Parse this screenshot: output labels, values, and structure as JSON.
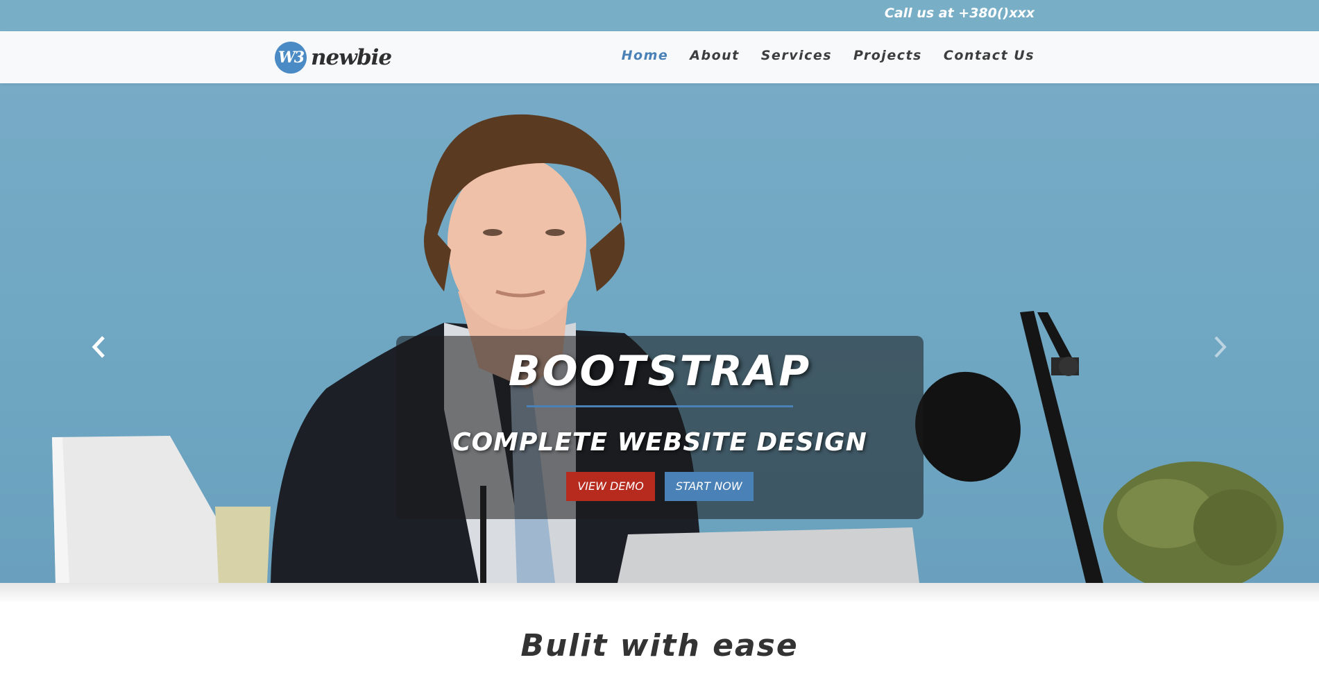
{
  "topbar": {
    "phone_text": "Call us at +380()xxx"
  },
  "brand": {
    "badge": "W3",
    "name": "newbie"
  },
  "nav": {
    "items": [
      "Home",
      "About",
      "Services",
      "Projects",
      "Contact Us"
    ],
    "active": "Home"
  },
  "hero": {
    "title": "BOOTSTRAP",
    "subtitle": "COMPLETE WEBSITE DESIGN",
    "buttons": {
      "view_demo": "VIEW DEMO",
      "start_now": "START NOW"
    },
    "controls": {
      "prev_icon": "chevron-left-icon",
      "next_icon": "chevron-right-icon"
    }
  },
  "section": {
    "title": "Bulit with ease"
  },
  "colors": {
    "topbar": "#78aec6",
    "accent": "#4a81b7",
    "demo_button": "#b72b1f",
    "hero_bg": "#77abc6"
  }
}
